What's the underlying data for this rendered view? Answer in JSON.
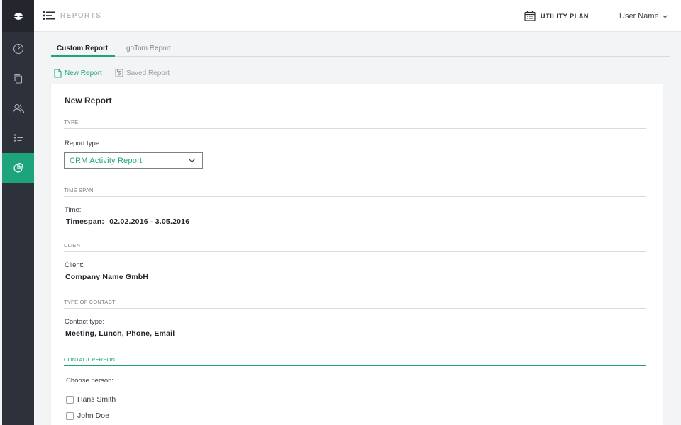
{
  "header": {
    "title": "REPORTS",
    "plan_label": "UTILITY PLAN",
    "user_name": "User Name"
  },
  "sidebar": {
    "items": [
      {
        "icon": "dashboard-icon"
      },
      {
        "icon": "documents-icon"
      },
      {
        "icon": "contacts-icon"
      },
      {
        "icon": "list-icon"
      },
      {
        "icon": "reports-pie-icon",
        "active": true
      }
    ]
  },
  "tabs": [
    {
      "label": "Custom Report",
      "active": true
    },
    {
      "label": "goTom Report",
      "active": false
    }
  ],
  "actions": {
    "new_report": "New Report",
    "saved_report": "Saved Report"
  },
  "form": {
    "title": "New Report",
    "sections": {
      "type": "TYPE",
      "time_span": "TIME SPAN",
      "client": "CLIENT",
      "type_of_contact": "TYPE OF CONTACT",
      "contact_person": "CONTACT PERSON"
    },
    "report_type_label": "Report type:",
    "report_type_value": "CRM Activity Report",
    "time_label": "Time:",
    "timespan_label": "Timespan:",
    "timespan_value": "02.02.2016 - 3.05.2016",
    "client_label": "Client:",
    "client_value": "Company Name GmbH",
    "contact_type_label": "Contact type:",
    "contact_type_value": "Meeting, Lunch, Phone, Email",
    "choose_person_label": "Choose person:",
    "persons": [
      {
        "name": "Hans Smith",
        "checked": false
      },
      {
        "name": "John Doe",
        "checked": false
      }
    ]
  },
  "colors": {
    "accent": "#1ea47c",
    "sidebar": "#2d323a",
    "sidebar_dark": "#23272d"
  }
}
